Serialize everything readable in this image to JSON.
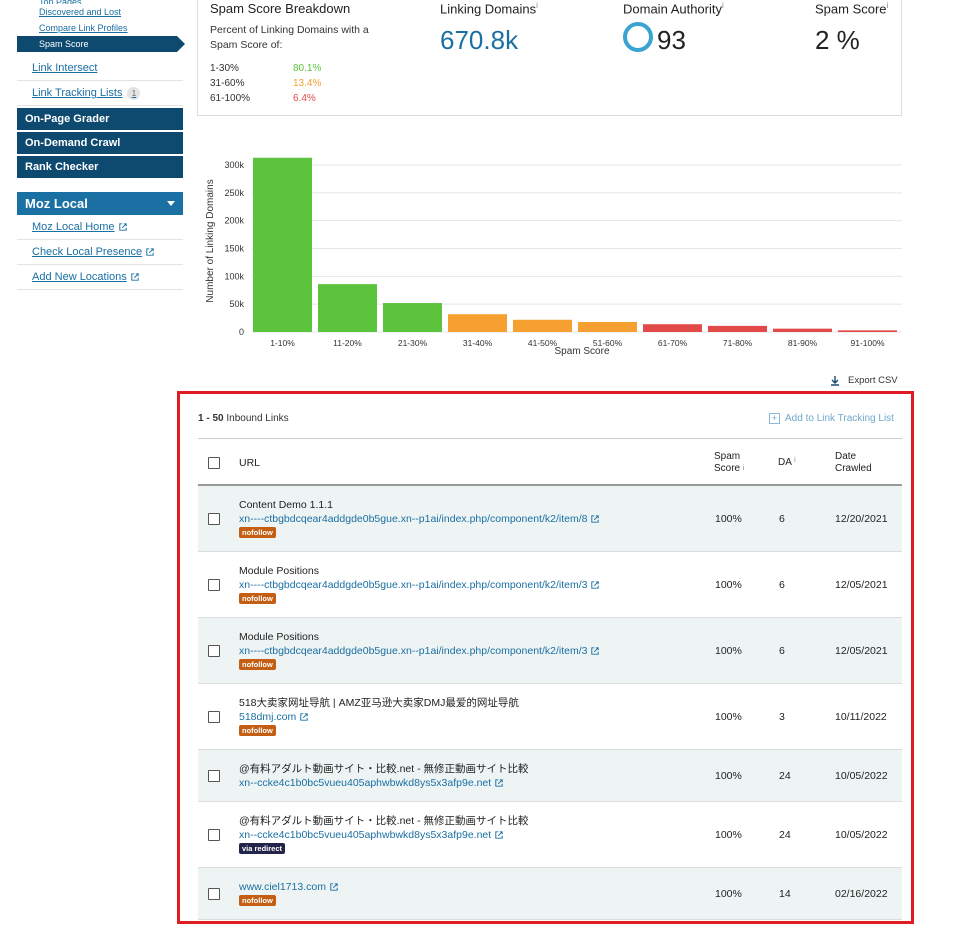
{
  "sidebar": {
    "clipped_link": "Top Pages",
    "sub_links": [
      "Discovered and Lost",
      "Compare Link Profiles"
    ],
    "active_sub": "Spam Score",
    "links": [
      {
        "label": "Link Intersect"
      },
      {
        "label": "Link Tracking Lists",
        "count": "1"
      }
    ],
    "sections": [
      "On-Page Grader",
      "On-Demand Crawl",
      "Rank Checker"
    ],
    "moz_local": {
      "title": "Moz Local",
      "links": [
        "Moz Local Home",
        "Check Local Presence",
        "Add New Locations"
      ]
    }
  },
  "metrics": {
    "breakdown_title": "Spam Score Breakdown",
    "breakdown_desc": "Percent of Linking Domains with a Spam Score of:",
    "breakdown": [
      {
        "range": "1-30%",
        "value": "80.1%",
        "color": "#5cc33c"
      },
      {
        "range": "31-60%",
        "value": "13.4%",
        "color": "#f5a030"
      },
      {
        "range": "61-100%",
        "value": "6.4%",
        "color": "#e24a4a"
      }
    ],
    "linking_domains_label": "Linking Domains",
    "linking_domains_value": "670.8k",
    "domain_authority_label": "Domain Authority",
    "domain_authority_value": "93",
    "spam_score_label": "Spam Score",
    "spam_score_value": "2 %",
    "info_mark": "i"
  },
  "chart_data": {
    "type": "bar",
    "categories": [
      "1-10%",
      "11-20%",
      "21-30%",
      "31-40%",
      "41-50%",
      "51-60%",
      "61-70%",
      "71-80%",
      "81-90%",
      "91-100%"
    ],
    "values": [
      313000,
      86000,
      52000,
      32000,
      22000,
      18000,
      14000,
      11000,
      6000,
      3000
    ],
    "colors": [
      "#5cc33c",
      "#5cc33c",
      "#5cc33c",
      "#f5a030",
      "#f5a030",
      "#f5a030",
      "#e24a4a",
      "#e24a4a",
      "#e24a4a",
      "#e24a4a"
    ],
    "xlabel": "Spam Score",
    "ylabel": "Number of Linking Domains",
    "yticks": [
      "0",
      "50k",
      "100k",
      "150k",
      "200k",
      "250k",
      "300k"
    ],
    "ylim": [
      0,
      300000
    ],
    "grid": true
  },
  "export_label": "Export CSV",
  "links_header": {
    "range": "1 - 50",
    "label": "Inbound Links",
    "add_tracking": "Add to Link Tracking List"
  },
  "table": {
    "headers": {
      "url": "URL",
      "spam_score": "Spam Score",
      "da": "DA",
      "date_crawled": "Date Crawled"
    },
    "rows": [
      {
        "title": "Content Demo 1.1.1",
        "url": "xn----ctbgbdcqear4addgde0b5gue.xn--p1ai/index.php/component/k2/item/8",
        "tag": "nofollow",
        "spam": "100%",
        "da": "6",
        "date": "12/20/2021"
      },
      {
        "title": "Module Positions",
        "url": "xn----ctbgbdcqear4addgde0b5gue.xn--p1ai/index.php/component/k2/item/3",
        "tag": "nofollow",
        "spam": "100%",
        "da": "6",
        "date": "12/05/2021"
      },
      {
        "title": "Module Positions",
        "url": "xn----ctbgbdcqear4addgde0b5gue.xn--p1ai/index.php/component/k2/item/3",
        "tag": "nofollow",
        "spam": "100%",
        "da": "6",
        "date": "12/05/2021"
      },
      {
        "title": "518大卖家网址导航 | AMZ亚马逊大卖家DMJ最爱的网址导航",
        "url": "518dmj.com",
        "tag": "nofollow",
        "spam": "100%",
        "da": "3",
        "date": "10/11/2022"
      },
      {
        "title": "@有料アダルト動画サイト・比較.net - 無修正動画サイト比較",
        "url": "xn--ccke4c1b0bc5vueu405aphwbwkd8ys5x3afp9e.net",
        "tag": "",
        "spam": "100%",
        "da": "24",
        "date": "10/05/2022"
      },
      {
        "title": "@有料アダルト動画サイト・比較.net - 無修正動画サイト比較",
        "url": "xn--ccke4c1b0bc5vueu405aphwbwkd8ys5x3afp9e.net",
        "tag": "via redirect",
        "spam": "100%",
        "da": "24",
        "date": "10/05/2022"
      },
      {
        "title": "",
        "url": "www.ciel1713.com",
        "tag": "nofollow",
        "spam": "100%",
        "da": "14",
        "date": "02/16/2022"
      }
    ]
  }
}
